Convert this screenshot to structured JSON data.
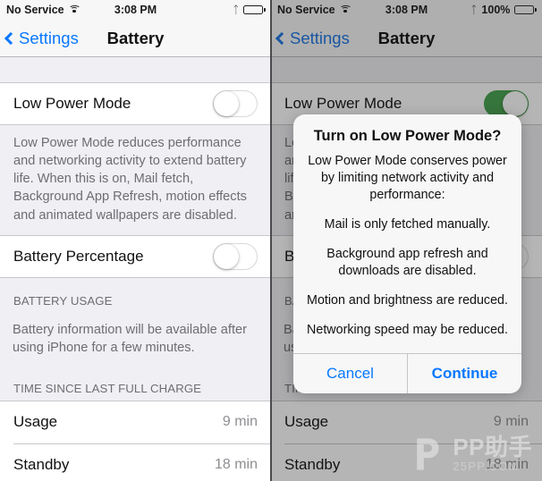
{
  "left": {
    "status": {
      "carrier": "No Service",
      "wifi_icon": "wifi-icon",
      "time": "3:08 PM",
      "bluetooth_icon": "bluetooth-icon",
      "battery_icon": "battery-full-icon",
      "battery_percent": ""
    },
    "nav": {
      "back_label": "Settings",
      "back_icon": "chevron-left-icon",
      "title": "Battery"
    },
    "low_power": {
      "label": "Low Power Mode",
      "state": "off"
    },
    "low_power_footnote": "Low Power Mode reduces performance and networking activity to extend battery life.  When this is on, Mail fetch, Background App Refresh, motion effects and animated wallpapers are disabled.",
    "battery_percentage": {
      "label": "Battery Percentage",
      "state": "off"
    },
    "battery_usage_header": "BATTERY USAGE",
    "battery_usage_note": "Battery information will be available after using iPhone for a few minutes.",
    "time_since_header": "TIME SINCE LAST FULL CHARGE",
    "time_rows": [
      {
        "label": "Usage",
        "value": "9 min"
      },
      {
        "label": "Standby",
        "value": "18 min"
      }
    ]
  },
  "right": {
    "status": {
      "carrier": "No Service",
      "wifi_icon": "wifi-icon",
      "time": "3:08 PM",
      "bluetooth_icon": "bluetooth-icon",
      "battery_icon": "battery-low-power-icon",
      "battery_percent": "100%"
    },
    "nav": {
      "back_label": "Settings",
      "back_icon": "chevron-left-icon",
      "title": "Battery"
    },
    "low_power": {
      "label": "Low Power Mode",
      "state": "on"
    },
    "low_power_footnote": "Low Power Mode reduces performance and networking activity to extend battery life.  When this is on, Mail fetch, Background App Refresh, motion effects and animated wallpapers are disabled.",
    "battery_percentage": {
      "label": "Battery Percentage",
      "state": "off"
    },
    "battery_usage_header": "BATTERY USAGE",
    "battery_usage_note": "Battery information will be available after using iPhone for a few minutes.",
    "time_since_header": "TIME SINCE LAST FULL CHARGE",
    "time_rows": [
      {
        "label": "Usage",
        "value": "9 min"
      },
      {
        "label": "Standby",
        "value": "18 min"
      }
    ],
    "alert": {
      "title": "Turn on Low Power Mode?",
      "paragraphs": [
        "Low Power Mode conserves power by limiting network activity and performance:",
        "Mail is only fetched manually.",
        "Background app refresh and downloads are disabled.",
        "Motion and brightness are reduced.",
        "Networking speed may be reduced."
      ],
      "cancel_label": "Cancel",
      "continue_label": "Continue"
    }
  },
  "watermark": {
    "main": "PP助手",
    "sub": "25PP.COM"
  },
  "colors": {
    "accent_blue": "#0a78ff",
    "toggle_on_green": "#37a83f",
    "battery_yellow": "#d6a119",
    "group_background": "#efeff4",
    "secondary_text": "#6d6d72"
  }
}
